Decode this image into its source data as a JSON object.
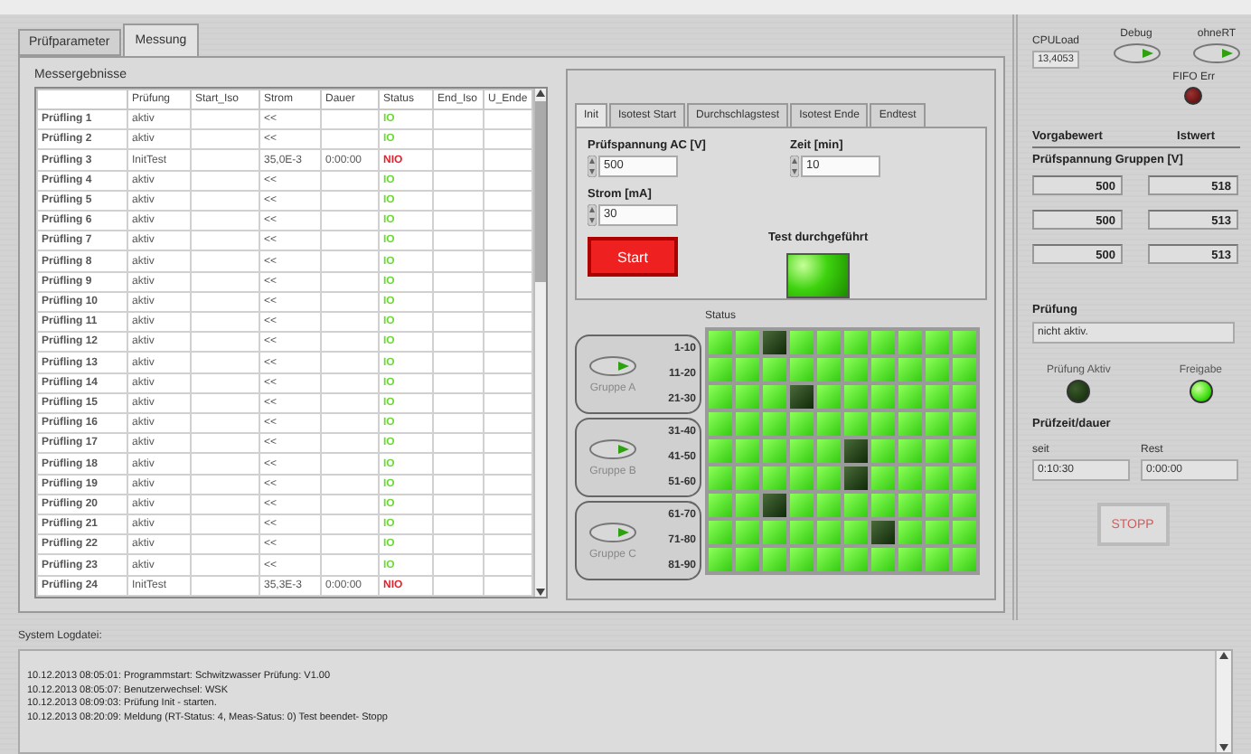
{
  "tabs": [
    {
      "label": "Prüfparameter",
      "selected": false
    },
    {
      "label": "Messung",
      "selected": true
    }
  ],
  "results": {
    "title": "Messergebnisse",
    "columns": [
      "Prüfung",
      "Start_Iso",
      "Strom",
      "Dauer",
      "Status",
      "End_Iso",
      "U_Ende"
    ],
    "rows": [
      {
        "name": "Prüfling 1",
        "pruefung": "aktiv",
        "strom": "<<",
        "status": "IO",
        "passed": true
      },
      {
        "name": "Prüfling 2",
        "pruefung": "aktiv",
        "strom": "<<",
        "status": "IO",
        "passed": true
      },
      {
        "name": "Prüfling 3",
        "pruefung": "InitTest",
        "strom": "35,0E-3",
        "dauer": "0:00:00",
        "status": "NIO",
        "passed": false
      },
      {
        "name": "Prüfling 4",
        "pruefung": "aktiv",
        "strom": "<<",
        "status": "IO",
        "passed": true
      },
      {
        "name": "Prüfling 5",
        "pruefung": "aktiv",
        "strom": "<<",
        "status": "IO",
        "passed": true
      },
      {
        "name": "Prüfling 6",
        "pruefung": "aktiv",
        "strom": "<<",
        "status": "IO",
        "passed": true
      },
      {
        "name": "Prüfling 7",
        "pruefung": "aktiv",
        "strom": "<<",
        "status": "IO",
        "passed": true
      },
      {
        "name": "Prüfling 8",
        "pruefung": "aktiv",
        "strom": "<<",
        "status": "IO",
        "passed": true
      },
      {
        "name": "Prüfling 9",
        "pruefung": "aktiv",
        "strom": "<<",
        "status": "IO",
        "passed": true
      },
      {
        "name": "Prüfling 10",
        "pruefung": "aktiv",
        "strom": "<<",
        "status": "IO",
        "passed": true
      },
      {
        "name": "Prüfling 11",
        "pruefung": "aktiv",
        "strom": "<<",
        "status": "IO",
        "passed": true
      },
      {
        "name": "Prüfling 12",
        "pruefung": "aktiv",
        "strom": "<<",
        "status": "IO",
        "passed": true
      },
      {
        "name": "Prüfling 13",
        "pruefung": "aktiv",
        "strom": "<<",
        "status": "IO",
        "passed": true
      },
      {
        "name": "Prüfling 14",
        "pruefung": "aktiv",
        "strom": "<<",
        "status": "IO",
        "passed": true
      },
      {
        "name": "Prüfling 15",
        "pruefung": "aktiv",
        "strom": "<<",
        "status": "IO",
        "passed": true
      },
      {
        "name": "Prüfling 16",
        "pruefung": "aktiv",
        "strom": "<<",
        "status": "IO",
        "passed": true
      },
      {
        "name": "Prüfling 17",
        "pruefung": "aktiv",
        "strom": "<<",
        "status": "IO",
        "passed": true
      },
      {
        "name": "Prüfling 18",
        "pruefung": "aktiv",
        "strom": "<<",
        "status": "IO",
        "passed": true
      },
      {
        "name": "Prüfling 19",
        "pruefung": "aktiv",
        "strom": "<<",
        "status": "IO",
        "passed": true
      },
      {
        "name": "Prüfling 20",
        "pruefung": "aktiv",
        "strom": "<<",
        "status": "IO",
        "passed": true
      },
      {
        "name": "Prüfling 21",
        "pruefung": "aktiv",
        "strom": "<<",
        "status": "IO",
        "passed": true
      },
      {
        "name": "Prüfling 22",
        "pruefung": "aktiv",
        "strom": "<<",
        "status": "IO",
        "passed": true
      },
      {
        "name": "Prüfling 23",
        "pruefung": "aktiv",
        "strom": "<<",
        "status": "IO",
        "passed": true
      },
      {
        "name": "Prüfling 24",
        "pruefung": "InitTest",
        "strom": "35,3E-3",
        "dauer": "0:00:00",
        "status": "NIO",
        "passed": false
      }
    ]
  },
  "test_tabs": [
    {
      "label": "Init",
      "selected": true
    },
    {
      "label": "Isotest Start",
      "selected": false
    },
    {
      "label": "Durchschlagstest",
      "selected": false
    },
    {
      "label": "Isotest Ende",
      "selected": false
    },
    {
      "label": "Endtest",
      "selected": false
    }
  ],
  "init": {
    "voltage": {
      "label": "Prüfspannung AC [V]",
      "value": "500"
    },
    "time": {
      "label": "Zeit [min]",
      "value": "10"
    },
    "current": {
      "label": "Strom [mA]",
      "value": "30"
    },
    "start_button": "Start",
    "done": {
      "label": "Test durchgeführt",
      "on": true
    }
  },
  "status": {
    "label": "Status",
    "groups": [
      {
        "name": "Gruppe A",
        "on": false,
        "ranges": [
          "1-10",
          "11-20",
          "21-30"
        ]
      },
      {
        "name": "Gruppe B",
        "on": false,
        "ranges": [
          "31-40",
          "41-50",
          "51-60"
        ]
      },
      {
        "name": "Gruppe C",
        "on": false,
        "ranges": [
          "61-70",
          "71-80",
          "81-90"
        ]
      }
    ],
    "lamps": [
      [
        true,
        true,
        false,
        true,
        true,
        true,
        true,
        true,
        true,
        true
      ],
      [
        true,
        true,
        true,
        true,
        true,
        true,
        true,
        true,
        true,
        true
      ],
      [
        true,
        true,
        true,
        false,
        true,
        true,
        true,
        true,
        true,
        true
      ],
      [
        true,
        true,
        true,
        true,
        true,
        true,
        true,
        true,
        true,
        true
      ],
      [
        true,
        true,
        true,
        true,
        true,
        false,
        true,
        true,
        true,
        true
      ],
      [
        true,
        true,
        true,
        true,
        true,
        false,
        true,
        true,
        true,
        true
      ],
      [
        true,
        true,
        false,
        true,
        true,
        true,
        true,
        true,
        true,
        true
      ],
      [
        true,
        true,
        true,
        true,
        true,
        true,
        false,
        true,
        true,
        true
      ],
      [
        true,
        true,
        true,
        true,
        true,
        true,
        true,
        true,
        true,
        true
      ]
    ]
  },
  "side": {
    "cpu": {
      "label": "CPULoad",
      "value": "13,4053"
    },
    "debug": {
      "label": "Debug",
      "on": false
    },
    "ohne_rt": {
      "label": "ohneRT",
      "on": false
    },
    "fifo": {
      "label": "FIFO Err",
      "on": false
    },
    "target_label": "Vorgabewert",
    "actual_label": "Istwert",
    "voltage_title": "Prüfspannung Gruppen [V]",
    "voltages": [
      {
        "target": "500",
        "actual": "518"
      },
      {
        "target": "500",
        "actual": "513"
      },
      {
        "target": "500",
        "actual": "513"
      }
    ],
    "test": {
      "label": "Prüfung",
      "value": "nicht aktiv."
    },
    "active": {
      "label": "Prüfung Aktiv",
      "on": false
    },
    "release": {
      "label": "Freigabe",
      "on": true
    },
    "time_title": "Prüfzeit/dauer",
    "since": {
      "label": "seit",
      "value": "0:10:30"
    },
    "rest": {
      "label": "Rest",
      "value": "0:00:00"
    },
    "stop": {
      "label": "STOPP",
      "disabled": true
    }
  },
  "log": {
    "title": "System Logdatei:",
    "lines": [
      "10.12.2013 08:05:01: Programmstart: Schwitzwasser Prüfung: V1.00",
      "10.12.2013 08:05:07: Benutzerwechsel: WSK",
      "10.12.2013 08:09:03: Prüfung Init - starten.",
      "10.12.2013 08:20:09: Meldung (RT-Status: 4, Meas-Satus: 0) Test beendet- Stopp"
    ]
  }
}
